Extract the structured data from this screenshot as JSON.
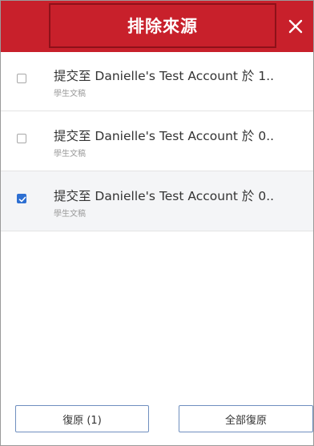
{
  "header": {
    "title": "排除來源",
    "close_icon": "close-icon",
    "accent_color": "#c8202b"
  },
  "items": [
    {
      "title": "提交至 Danielle's Test Account 於 1..",
      "subtitle": "學生文稿",
      "checked": false
    },
    {
      "title": "提交至 Danielle's Test Account 於 0..",
      "subtitle": "學生文稿",
      "checked": false
    },
    {
      "title": "提交至 Danielle's Test Account 於 0..",
      "subtitle": "學生文稿",
      "checked": true
    }
  ],
  "footer": {
    "restore_label": "復原 (1)",
    "restore_all_label": "全部復原"
  }
}
